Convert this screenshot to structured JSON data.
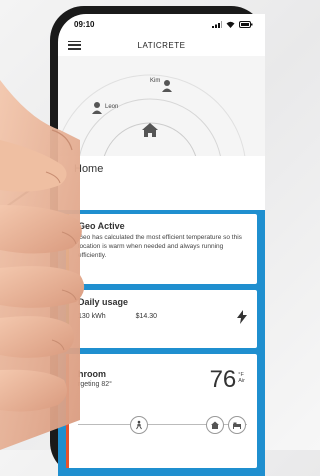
{
  "status": {
    "time": "09:10"
  },
  "app": {
    "title": "LATICRETE"
  },
  "geo_map": {
    "users": [
      "Kim",
      "Leon"
    ]
  },
  "home": {
    "label": "Home"
  },
  "geo_card": {
    "title": "Geo Active",
    "body": "Geo has calculated the most efficient temperature so this location is warm when needed and always running efficiently."
  },
  "usage_card": {
    "title": "Daily usage",
    "energy": "130 kWh",
    "cost": "$14.30"
  },
  "zone_card": {
    "name": "hroom",
    "target": "rgeting 82°",
    "temperature": "76",
    "unit": "°F",
    "mode": "Air"
  },
  "colors": {
    "accent": "#1f8fcf",
    "geo_bar": "#f2cf1d",
    "usage_bar": "#3fae4a",
    "zone_bar": "#e6522c"
  }
}
